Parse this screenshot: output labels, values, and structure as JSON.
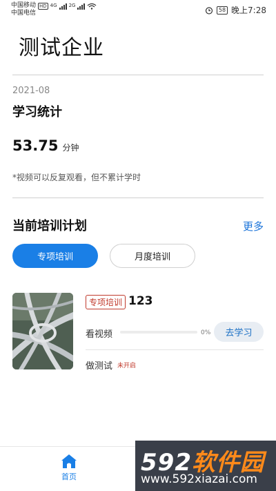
{
  "status_bar": {
    "carrier1": "中国移动",
    "hd": "HD",
    "net1": "4G",
    "net2": "2G",
    "carrier2": "中国电信",
    "battery": "58",
    "time": "晚上7:28"
  },
  "company": "测试企业",
  "stats": {
    "month": "2021-08",
    "title": "学习统计",
    "minutes_value": "53.75",
    "minutes_unit": "分钟",
    "note": "*视频可以反复观看，但不累计学时"
  },
  "plan": {
    "title": "当前培训计划",
    "more": "更多",
    "tabs": [
      {
        "label": "专项培训",
        "active": true
      },
      {
        "label": "月度培训",
        "active": false
      }
    ]
  },
  "course": {
    "badge": "专项培训",
    "name": "123",
    "video_label": "看视频",
    "progress_percent": 0,
    "progress_text": "0%",
    "button": "去学习",
    "test_label": "做测试",
    "test_status": "未开启"
  },
  "nav": {
    "home": "首页"
  },
  "watermark": {
    "logo_num": "592",
    "logo_text": "软件园",
    "url": "www.592xiazai.com"
  },
  "colors": {
    "accent": "#1a7fe6",
    "badge": "#c0392b"
  }
}
